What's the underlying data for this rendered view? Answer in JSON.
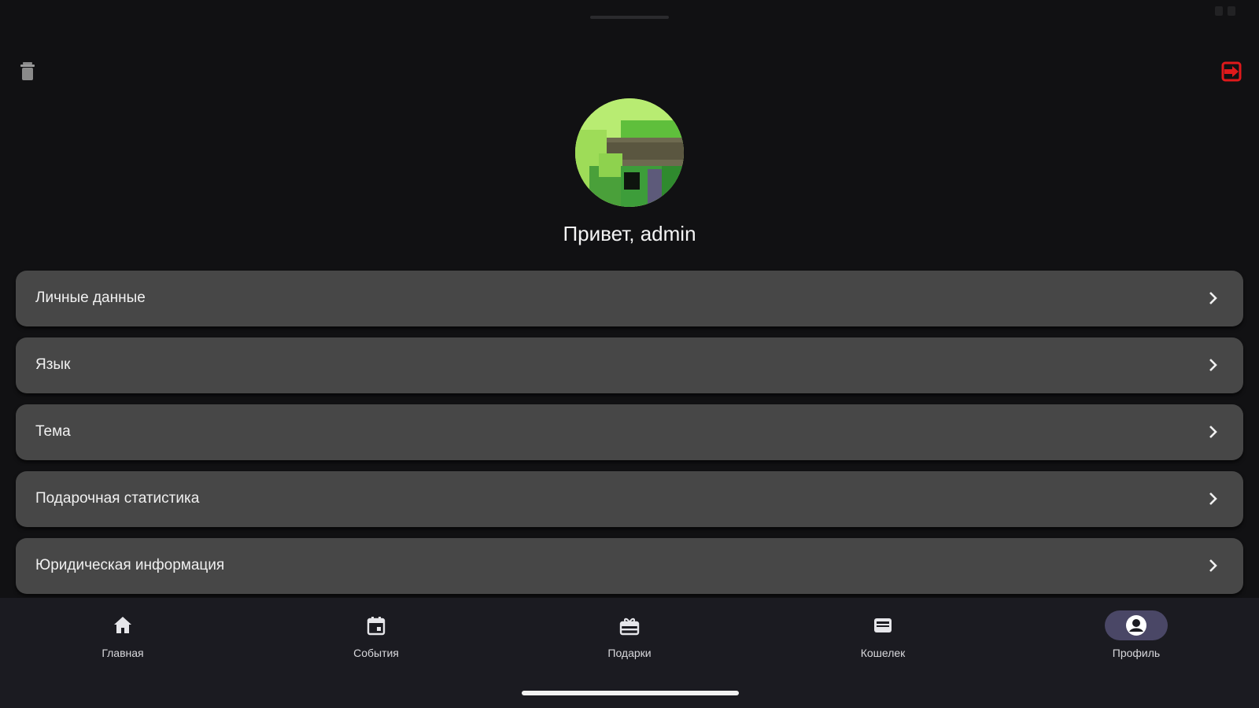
{
  "colors": {
    "background": "#111113",
    "card": "#474747",
    "nav_background": "#1b1b21",
    "nav_active_pill": "#4a4766",
    "logout_accent": "#e0191b",
    "text": "#f2f2f2"
  },
  "top_bar": {
    "left_icon": "trash-icon",
    "right_icon": "logout-icon"
  },
  "profile": {
    "avatar_icon": "pixel-avatar",
    "greeting": "Привет, admin"
  },
  "menu": {
    "items": [
      {
        "label": "Личные данные",
        "icon": "chevron-right-icon"
      },
      {
        "label": "Язык",
        "icon": "chevron-right-icon"
      },
      {
        "label": "Тема",
        "icon": "chevron-right-icon"
      },
      {
        "label": "Подарочная статистика",
        "icon": "chevron-right-icon"
      },
      {
        "label": "Юридическая информация",
        "icon": "chevron-right-icon"
      }
    ]
  },
  "bottom_nav": {
    "items": [
      {
        "label": "Главная",
        "icon": "home-icon",
        "active": false
      },
      {
        "label": "События",
        "icon": "calendar-icon",
        "active": false
      },
      {
        "label": "Подарки",
        "icon": "gift-icon",
        "active": false
      },
      {
        "label": "Кошелек",
        "icon": "wallet-icon",
        "active": false
      },
      {
        "label": "Профиль",
        "icon": "profile-icon",
        "active": true
      }
    ]
  }
}
